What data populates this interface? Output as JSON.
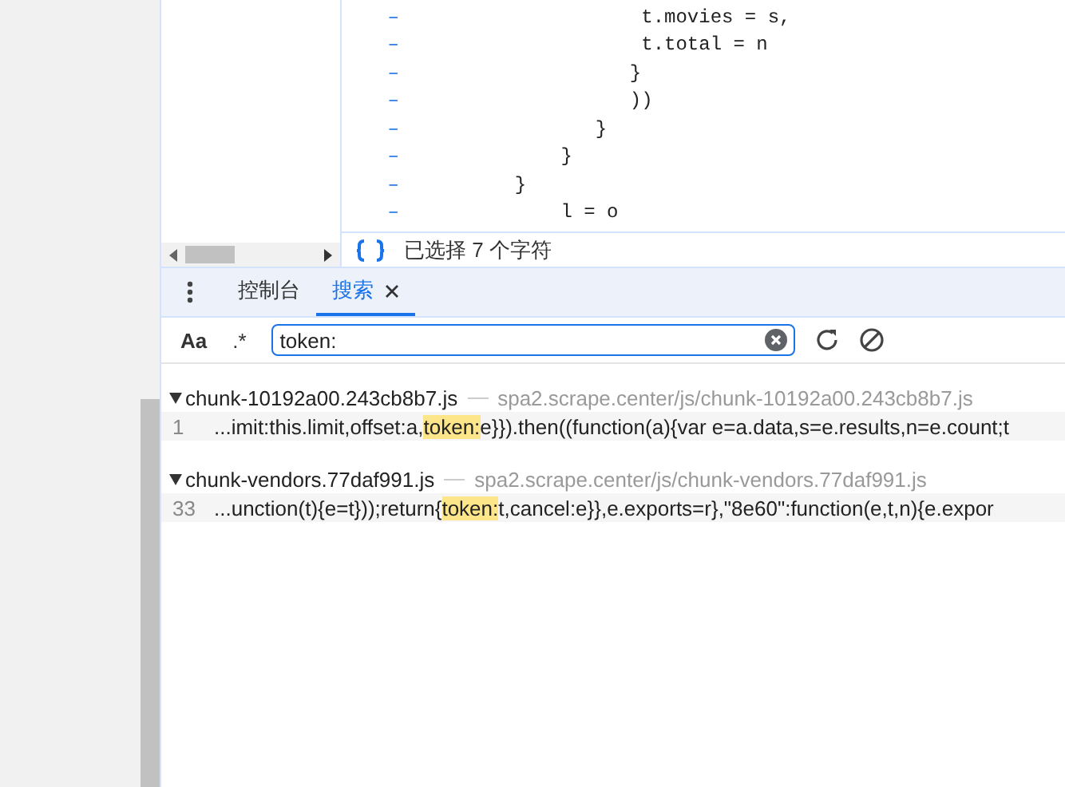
{
  "code_lines": [
    {
      "marker": "–",
      "text": "                  t.movies = s,"
    },
    {
      "marker": "–",
      "text": "                  t.total = n"
    },
    {
      "marker": "–",
      "text": "                 }"
    },
    {
      "marker": "–",
      "text": "                 ))"
    },
    {
      "marker": "–",
      "text": "              }"
    },
    {
      "marker": "–",
      "text": "           }"
    },
    {
      "marker": "–",
      "text": "       }"
    },
    {
      "marker": "–",
      "text": "           l = o"
    }
  ],
  "status_bar": {
    "text": "已选择 7 个字符"
  },
  "drawer_tabs": [
    {
      "label": "控制台",
      "selected": false,
      "closable": false
    },
    {
      "label": "搜索",
      "selected": true,
      "closable": true
    }
  ],
  "search": {
    "case_toggle": "Aa",
    "regex_toggle": ".*",
    "value": "token:"
  },
  "results": [
    {
      "file": "chunk-10192a00.243cb8b7.js",
      "url": "spa2.scrape.center/js/chunk-10192a00.243cb8b7.js",
      "expanded": true,
      "matches": [
        {
          "line": "1",
          "before": "...imit:this.limit,offset:a,",
          "match": "token:",
          "after": "e}}).then((function(a){var e=a.data,s=e.results,n=e.count;t"
        }
      ]
    },
    {
      "file": "chunk-vendors.77daf991.js",
      "url": "spa2.scrape.center/js/chunk-vendors.77daf991.js",
      "expanded": true,
      "matches": [
        {
          "line": "33",
          "before": "...unction(t){e=t}));return{",
          "match": "token:",
          "after": "t,cancel:e}},e.exports=r},\"8e60\":function(e,t,n){e.expor"
        }
      ]
    }
  ]
}
